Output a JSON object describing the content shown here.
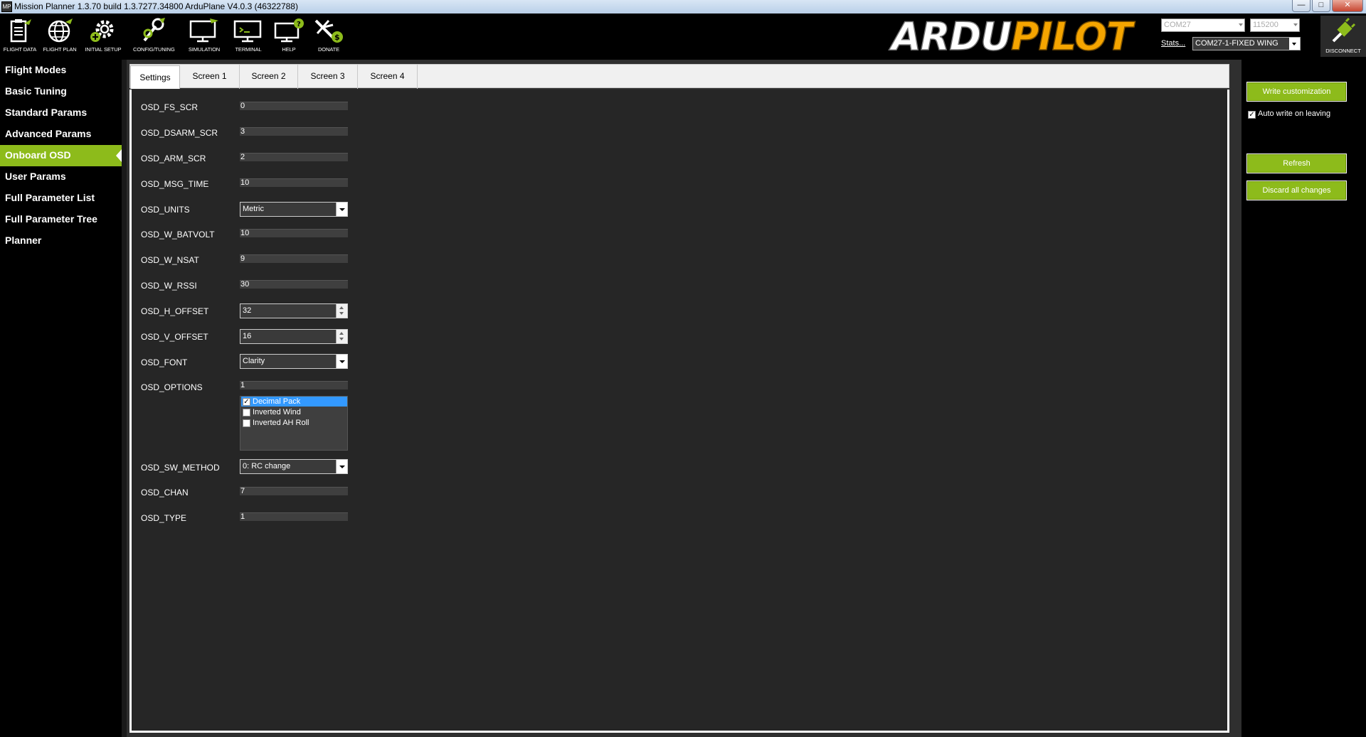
{
  "window": {
    "app_icon": "MP",
    "title": "Mission Planner 1.3.70 build 1.3.7277.34800 ArduPlane V4.0.3 (46322788)",
    "minimize": "—",
    "maximize": "□",
    "close": "✕"
  },
  "toolbar": {
    "items": [
      {
        "label": "FLIGHT DATA",
        "icon": "clipboard-icon"
      },
      {
        "label": "FLIGHT PLAN",
        "icon": "globe-icon"
      },
      {
        "label": "INITIAL SETUP",
        "icon": "gear-icon"
      },
      {
        "label": "CONFIG/TUNING",
        "icon": "wrench-icon"
      },
      {
        "label": "SIMULATION",
        "icon": "monitor-plane-icon"
      },
      {
        "label": "TERMINAL",
        "icon": "terminal-icon"
      },
      {
        "label": "HELP",
        "icon": "help-icon"
      },
      {
        "label": "DONATE",
        "icon": "donate-icon"
      }
    ],
    "logo_part1": "ARDU",
    "logo_part2": "PILOT",
    "port": "COM27",
    "baud": "115200",
    "stats_link": "Stats...",
    "connection": "COM27-1-FIXED WING",
    "disconnect_label": "DISCONNECT"
  },
  "sidebar": {
    "items": [
      {
        "label": "Flight Modes"
      },
      {
        "label": "Basic Tuning"
      },
      {
        "label": "Standard Params"
      },
      {
        "label": "Advanced Params"
      },
      {
        "label": "Onboard OSD",
        "active": true
      },
      {
        "label": "User Params"
      },
      {
        "label": "Full Parameter List"
      },
      {
        "label": "Full Parameter Tree"
      },
      {
        "label": "Planner"
      }
    ]
  },
  "tabs": [
    "Settings",
    "Screen 1",
    "Screen 2",
    "Screen 3",
    "Screen 4"
  ],
  "params": {
    "fs_scr": {
      "label": "OSD_FS_SCR",
      "value": "0"
    },
    "dsarm_scr": {
      "label": "OSD_DSARM_SCR",
      "value": "3"
    },
    "arm_scr": {
      "label": "OSD_ARM_SCR",
      "value": "2"
    },
    "msg_time": {
      "label": "OSD_MSG_TIME",
      "value": "10"
    },
    "units": {
      "label": "OSD_UNITS",
      "value": "Metric"
    },
    "w_batvolt": {
      "label": "OSD_W_BATVOLT",
      "value": "10"
    },
    "w_nsat": {
      "label": "OSD_W_NSAT",
      "value": "9"
    },
    "w_rssi": {
      "label": "OSD_W_RSSI",
      "value": "30"
    },
    "h_offset": {
      "label": "OSD_H_OFFSET",
      "value": "32"
    },
    "v_offset": {
      "label": "OSD_V_OFFSET",
      "value": "16"
    },
    "font": {
      "label": "OSD_FONT",
      "value": "Clarity"
    },
    "options": {
      "label": "OSD_OPTIONS",
      "value": "1",
      "items": [
        {
          "label": "Decimal Pack",
          "checked": "✓"
        },
        {
          "label": "Inverted Wind",
          "checked": ""
        },
        {
          "label": "Inverted AH Roll",
          "checked": ""
        }
      ]
    },
    "sw_method": {
      "label": "OSD_SW_METHOD",
      "value": "0: RC change"
    },
    "chan": {
      "label": "OSD_CHAN",
      "value": "7"
    },
    "type": {
      "label": "OSD_TYPE",
      "value": "1"
    }
  },
  "right": {
    "write_btn": "Write customization",
    "auto_write_label": "Auto write on leaving",
    "auto_write_check": "✓",
    "refresh_btn": "Refresh",
    "discard_btn": "Discard all changes"
  },
  "colors": {
    "accent_green": "#8dbb1b",
    "logo_orange": "#f5a500",
    "selection_blue": "#3399ff"
  }
}
